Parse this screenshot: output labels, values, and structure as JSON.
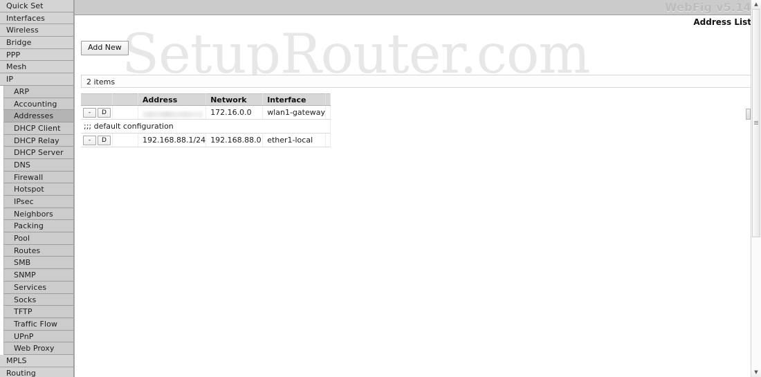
{
  "app": {
    "brand": "WebFig v5.14",
    "page_title": "Address List",
    "watermark": "SetupRouter.com"
  },
  "sidebar": {
    "items": [
      {
        "label": "Quick Set",
        "level": 0,
        "selected": false
      },
      {
        "label": "Interfaces",
        "level": 0,
        "selected": false
      },
      {
        "label": "Wireless",
        "level": 0,
        "selected": false
      },
      {
        "label": "Bridge",
        "level": 0,
        "selected": false
      },
      {
        "label": "PPP",
        "level": 0,
        "selected": false
      },
      {
        "label": "Mesh",
        "level": 0,
        "selected": false
      },
      {
        "label": "IP",
        "level": 0,
        "selected": false
      },
      {
        "label": "ARP",
        "level": 1,
        "selected": false
      },
      {
        "label": "Accounting",
        "level": 1,
        "selected": false
      },
      {
        "label": "Addresses",
        "level": 1,
        "selected": true
      },
      {
        "label": "DHCP Client",
        "level": 1,
        "selected": false
      },
      {
        "label": "DHCP Relay",
        "level": 1,
        "selected": false
      },
      {
        "label": "DHCP Server",
        "level": 1,
        "selected": false
      },
      {
        "label": "DNS",
        "level": 1,
        "selected": false
      },
      {
        "label": "Firewall",
        "level": 1,
        "selected": false
      },
      {
        "label": "Hotspot",
        "level": 1,
        "selected": false
      },
      {
        "label": "IPsec",
        "level": 1,
        "selected": false
      },
      {
        "label": "Neighbors",
        "level": 1,
        "selected": false
      },
      {
        "label": "Packing",
        "level": 1,
        "selected": false
      },
      {
        "label": "Pool",
        "level": 1,
        "selected": false
      },
      {
        "label": "Routes",
        "level": 1,
        "selected": false
      },
      {
        "label": "SMB",
        "level": 1,
        "selected": false
      },
      {
        "label": "SNMP",
        "level": 1,
        "selected": false
      },
      {
        "label": "Services",
        "level": 1,
        "selected": false
      },
      {
        "label": "Socks",
        "level": 1,
        "selected": false
      },
      {
        "label": "TFTP",
        "level": 1,
        "selected": false
      },
      {
        "label": "Traffic Flow",
        "level": 1,
        "selected": false
      },
      {
        "label": "UPnP",
        "level": 1,
        "selected": false
      },
      {
        "label": "Web Proxy",
        "level": 1,
        "selected": false
      },
      {
        "label": "MPLS",
        "level": 0,
        "selected": false
      },
      {
        "label": "Routing",
        "level": 0,
        "selected": false
      }
    ]
  },
  "toolbar": {
    "add_new_label": "Add New"
  },
  "list": {
    "count_label": "2 items",
    "columns": [
      "",
      "",
      "Address",
      "Network",
      "Interface",
      ""
    ],
    "rows": [
      {
        "type": "entry",
        "disable_label": "-",
        "comment_label": "D",
        "flag": "",
        "address": "",
        "address_redacted": true,
        "network": "172.16.0.0",
        "interface": "wlan1-gateway"
      },
      {
        "type": "comment",
        "text": ";;; default configuration"
      },
      {
        "type": "entry",
        "disable_label": "-",
        "comment_label": "D",
        "flag": "",
        "address": "192.168.88.1/24",
        "address_redacted": false,
        "network": "192.168.88.0",
        "interface": "ether1-local"
      }
    ]
  },
  "scrollbar": {
    "up_arrow": "▲",
    "down_arrow": "▼"
  },
  "colors": {
    "sidebar_bg": "#d4d4d4",
    "sidebar_selected": "#b4b4b4",
    "topbar_bg": "#cbcbcb",
    "brand_text": "#bcbcbc",
    "watermark": "#e7e7e7"
  }
}
